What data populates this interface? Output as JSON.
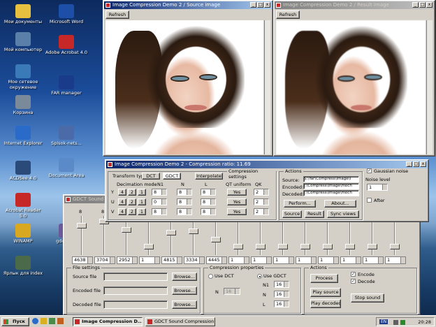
{
  "desktop": {
    "icons": [
      {
        "name": "my-documents-icon",
        "label": "Мои документы",
        "color": "#e8c040"
      },
      {
        "name": "word-icon",
        "label": "Microsoft Word",
        "color": "#1e4fa8"
      },
      {
        "name": "my-computer-icon",
        "label": "Мой компьютер",
        "color": "#5a7fa8"
      },
      {
        "name": "acrobat-icon",
        "label": "Adobe Acrobat 4.0",
        "color": "#c62828"
      },
      {
        "name": "network-icon",
        "label": "Мое сетевое окружение",
        "color": "#3a7ab8"
      },
      {
        "name": "far-manager-icon",
        "label": "FAR manager",
        "color": "#1a3a8a"
      },
      {
        "name": "recycle-bin-icon",
        "label": "Корзина",
        "color": "#7a8a9a"
      },
      {
        "name": "ie-icon",
        "label": "Internet Explorer",
        "color": "#2a6ac8"
      },
      {
        "name": "doc-file-icon",
        "label": "Spisok-nets...",
        "color": "#4a6aa8"
      },
      {
        "name": "acdsee-icon",
        "label": "ACDSee 4.0",
        "color": "#2a4a7a"
      },
      {
        "name": "document-icon",
        "label": "Document Area",
        "color": "#5a8ac8"
      },
      {
        "name": "acrobat-reader-icon",
        "label": "Acrobat Reader 5.0",
        "color": "#c62828"
      },
      {
        "name": "winamp-icon",
        "label": "WINAMP",
        "color": "#d8a820"
      },
      {
        "name": "gdct-icon",
        "label": "gdct_info",
        "color": "#6a5a9a"
      },
      {
        "name": "shortcut-icon",
        "label": "Ярлык для index",
        "color": "#4a6a4a"
      }
    ]
  },
  "sound_window": {
    "title": "GDCT Sound C",
    "slider_label": "8"
  },
  "source_window": {
    "title": "Image Compression Demo 2 / Source image",
    "refresh": "Refresh"
  },
  "result_window": {
    "title": "Image Compression Demo 2 / Result image",
    "refresh": "Refresh"
  },
  "main_window": {
    "title": "Image Compression Demo 2 - Compression ratio: 11.69",
    "transform_type_label": "Transform type:",
    "transform_tabs": [
      "DCT",
      "GDCT",
      "Interpolate"
    ],
    "compression_settings": "Compression settings",
    "headers": {
      "decimation": "Decimation mode",
      "n1": "N1",
      "n": "N",
      "l": "L",
      "qt": "QT uniform",
      "qk": "QK"
    },
    "rows": [
      {
        "ch": "Y",
        "d": [
          "4",
          "2",
          "1"
        ],
        "n1": "8",
        "n": "8",
        "l": "8",
        "qt": "Yes",
        "qk": "2"
      },
      {
        "ch": "U",
        "d": [
          "4",
          "2",
          "1"
        ],
        "n1": "0",
        "n": "8",
        "l": "8",
        "qt": "Yes",
        "qk": "2"
      },
      {
        "ch": "V",
        "d": [
          "4",
          "2",
          "1"
        ],
        "n1": "8",
        "n": "8",
        "l": "8",
        "qt": "Yes",
        "qk": "2"
      }
    ],
    "actions": "Actions",
    "source_label": "Source:",
    "source_val": "S:\\Yar\\Compress\\Image\\I",
    "encoded_label": "Encoded:",
    "encoded_val": "I:\\Compress\\Image\\moch",
    "decoded_label": "Decoded:",
    "decoded_val": "I:\\Compress\\Image\\moch",
    "perform": "Perform...",
    "about": "About...",
    "source_btn": "Source",
    "result_btn": "Result",
    "sync_btn": "Sync views",
    "gaussian": "Gaussian noise",
    "noise_level": "Noise level",
    "noise_val": "1",
    "after": "After"
  },
  "sound_panel": {
    "spin_values": [
      "4638",
      "3704",
      "2952",
      "1",
      "4815",
      "3334",
      "4445",
      "1",
      "1",
      "1",
      "1",
      "1",
      "1",
      "1",
      "1"
    ],
    "file_settings": "File settings",
    "source_file": "Source file",
    "encoded_file": "Encoded file",
    "decoded_file": "Decoded file",
    "browse": "Browse...",
    "comp_props": "Compression properties",
    "use_dct": "Use DCT",
    "use_gdct": "Use GDCT",
    "n_label": "N",
    "n_val": "16",
    "n1_label": "N1",
    "n1_val": "16",
    "n2_label": "N",
    "n2_val": "16",
    "l_label": "L",
    "l_val": "16",
    "actions": "Actions",
    "process": "Process",
    "encode": "Encode",
    "decode": "Decode",
    "play_source": "Play source",
    "play_decoded": "Play decoded",
    "stop_sound": "Stop sound"
  },
  "taskbar": {
    "start": "Пуск",
    "tasks": [
      "Image Compression D...",
      "GDCT Sound Compression..."
    ],
    "lang": "EN",
    "time": "20:28"
  }
}
